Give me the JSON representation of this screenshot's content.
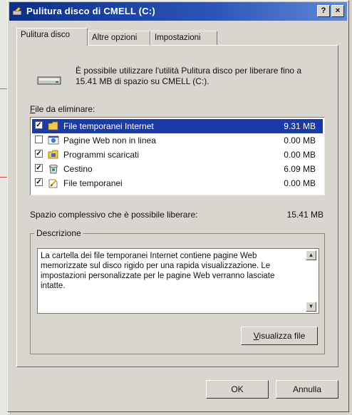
{
  "window": {
    "title": "Pulitura disco di CMELL (C:)",
    "help_btn": "?",
    "close_btn": "×"
  },
  "tabs": [
    {
      "label": "Pulitura disco",
      "active": true
    },
    {
      "label": "Altre opzioni",
      "active": false
    },
    {
      "label": "Impostazioni",
      "active": false
    }
  ],
  "intro_text": "È possibile utilizzare l'utilità Pulitura disco per liberare fino a 15.41 MB di spazio su CMELL (C:).",
  "files_label": "File da eliminare:",
  "files": [
    {
      "name": "File temporanei Internet",
      "size": "9.31 MB",
      "checked": true,
      "selected": true,
      "icon": "folder-icon"
    },
    {
      "name": "Pagine Web non in linea",
      "size": "0.00 MB",
      "checked": false,
      "selected": false,
      "icon": "web-page-icon"
    },
    {
      "name": "Programmi scaricati",
      "size": "0.00 MB",
      "checked": true,
      "selected": false,
      "icon": "program-folder-icon"
    },
    {
      "name": "Cestino",
      "size": "6.09 MB",
      "checked": true,
      "selected": false,
      "icon": "recycle-bin-icon"
    },
    {
      "name": "File temporanei",
      "size": "0.00 MB",
      "checked": true,
      "selected": false,
      "icon": "temp-files-icon"
    }
  ],
  "total_label": "Spazio complessivo che è possibile liberare:",
  "total_value": "15.41 MB",
  "description_label": "Descrizione",
  "description_text": "La cartella dei file temporanei Internet contiene pagine Web memorizzate sul disco rigido per una rapida visualizzazione. Le impostazioni personalizzate per le pagine Web verranno lasciate intatte.",
  "view_files_button": "Visualizza file",
  "ok_button": "OK",
  "cancel_button": "Annulla",
  "colors": {
    "titlebar": "#0b2f86",
    "selection": "#1b3aa6",
    "dialog_bg": "#d9d6cf"
  }
}
